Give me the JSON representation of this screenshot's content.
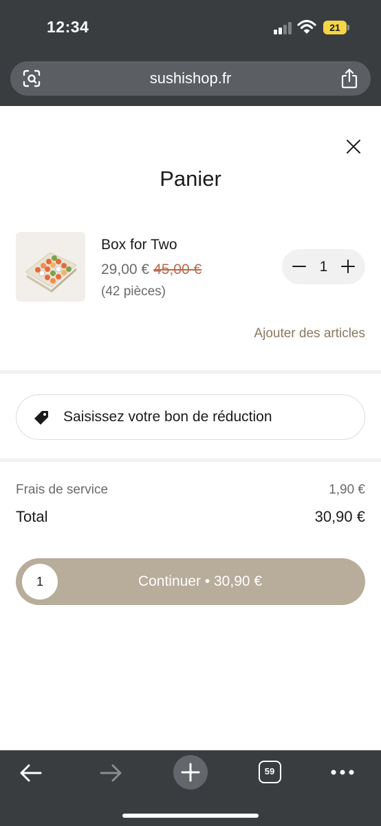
{
  "status_bar": {
    "time": "12:34",
    "battery": "21",
    "icons": [
      "signal-icon",
      "wifi-icon",
      "battery-charging-icon"
    ]
  },
  "browser": {
    "url": "sushishop.fr",
    "icons": [
      "visual-lookup-icon",
      "share-icon"
    ]
  },
  "cart": {
    "title": "Panier",
    "item": {
      "name": "Box for Two",
      "price": "29,00 €",
      "old_price": "45,00 €",
      "pieces": "(42 pièces)",
      "quantity": "1"
    },
    "add_articles": "Ajouter des articles",
    "promo_placeholder": "Saisissez votre bon de réduction",
    "fees": {
      "label": "Frais de service",
      "value": "1,90 €"
    },
    "total": {
      "label": "Total",
      "value": "30,90 €"
    },
    "continue_button": {
      "count": "1",
      "label": "Continuer • 30,90 €"
    }
  },
  "toolbar": {
    "tabs_count": "59",
    "icons": [
      "back-arrow-icon",
      "forward-arrow-icon",
      "new-tab-plus-icon",
      "tabs-icon",
      "more-icon"
    ]
  },
  "colors": {
    "chrome": "#3a3d40",
    "accent_button": "#b8ac9a",
    "old_price": "#b86a4a",
    "link": "#8a7860",
    "battery": "#f5d547"
  }
}
